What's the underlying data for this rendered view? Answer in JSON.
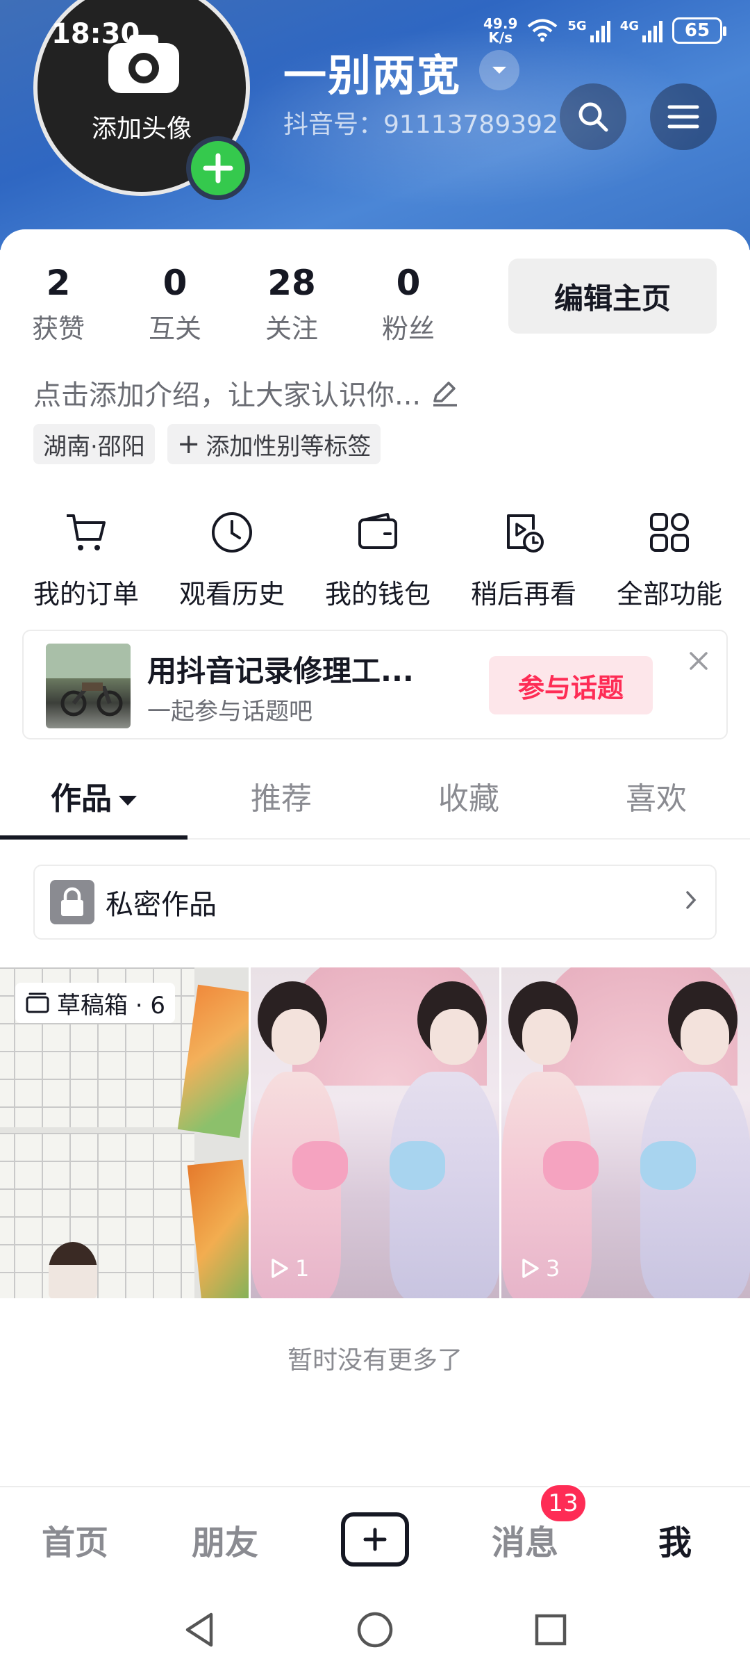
{
  "status_bar": {
    "time": "18:30",
    "net_speed_value": "49.9",
    "net_speed_unit": "K/s",
    "signal_1_label": "5G",
    "signal_2_label": "4G",
    "battery": "65"
  },
  "profile": {
    "avatar_text": "添加头像",
    "username": "一别两宽",
    "douyin_id": "抖音号：91113789392 ",
    "stats": [
      {
        "value": "2",
        "label": "获赞"
      },
      {
        "value": "0",
        "label": "互关"
      },
      {
        "value": "28",
        "label": "关注"
      },
      {
        "value": "0",
        "label": "粉丝"
      }
    ],
    "edit_button": "编辑主页",
    "bio_placeholder": "点击添加介绍，让大家认识你...",
    "tags": [
      "湖南·邵阳",
      "添加性别等标签"
    ]
  },
  "functions": [
    {
      "label": "我的订单",
      "icon": "cart-icon"
    },
    {
      "label": "观看历史",
      "icon": "clock-icon"
    },
    {
      "label": "我的钱包",
      "icon": "wallet-icon"
    },
    {
      "label": "稍后再看",
      "icon": "watch-later-icon"
    },
    {
      "label": "全部功能",
      "icon": "grid-apps-icon"
    }
  ],
  "topic_banner": {
    "title": "用抖音记录修理工...",
    "subtitle": "一起参与话题吧",
    "button": "参与话题"
  },
  "content_tabs": [
    "作品",
    "推荐",
    "收藏",
    "喜欢"
  ],
  "private_works": "私密作品",
  "grid": {
    "draft_label": "草稿箱 · 6",
    "items": [
      {
        "plays": "1"
      },
      {
        "plays": "3"
      }
    ]
  },
  "no_more_text": "暂时没有更多了",
  "bottom_nav": {
    "items": [
      "首页",
      "朋友",
      "消息",
      "我"
    ],
    "messages_badge": "13"
  },
  "colors": {
    "accent_red": "#fe2c55",
    "header_blue": "#2f67c2",
    "add_green": "#35c94d"
  }
}
